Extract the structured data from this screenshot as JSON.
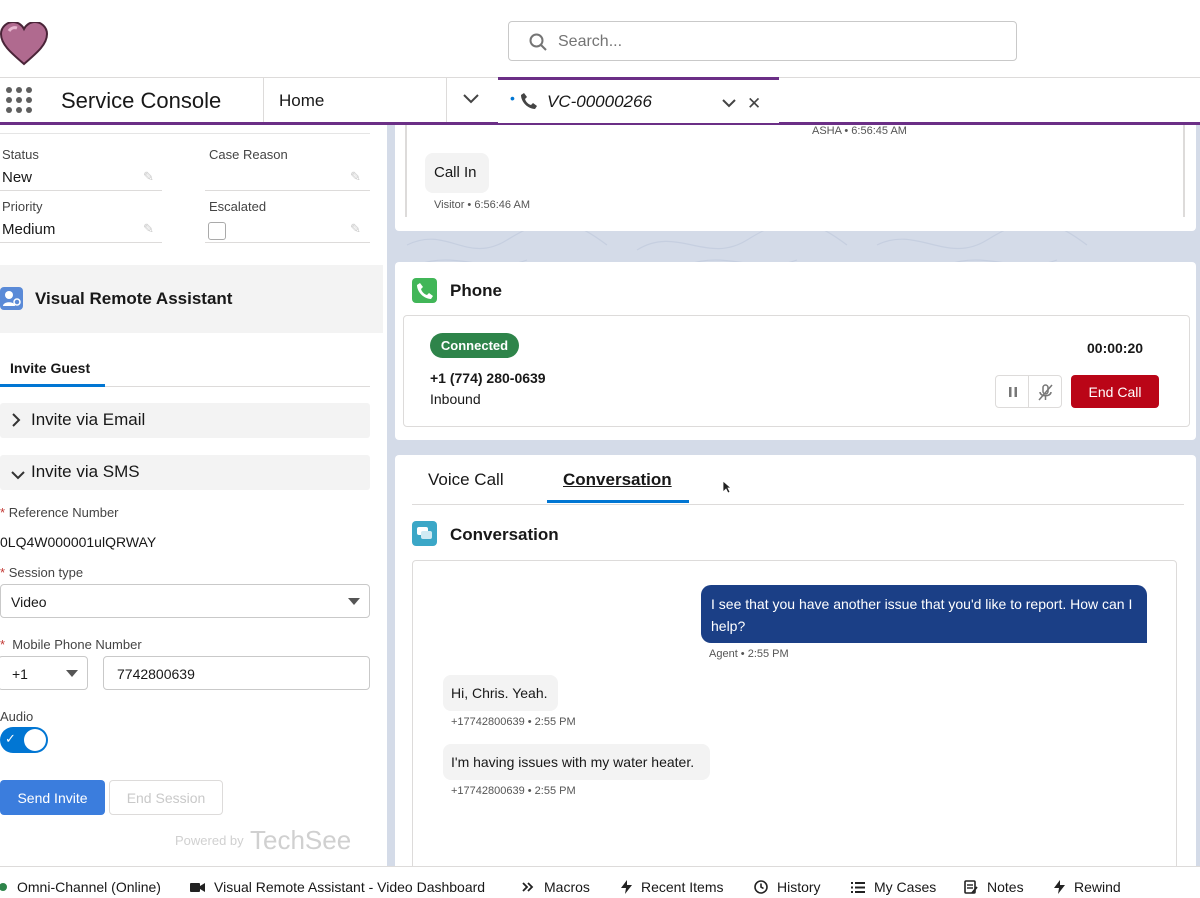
{
  "header": {
    "search_placeholder": "Search..."
  },
  "nav": {
    "app_name": "Service Console",
    "home_tab": "Home",
    "case_tab": "VC-00000266"
  },
  "record_fields": {
    "status_label": "Status",
    "status_value": "New",
    "case_reason_label": "Case Reason",
    "priority_label": "Priority",
    "priority_value": "Medium",
    "escalated_label": "Escalated"
  },
  "vra": {
    "title": "Visual Remote Assistant",
    "tab": "Invite Guest",
    "invite_email": "Invite via Email",
    "invite_sms": "Invite via SMS",
    "ref_label": "Reference Number",
    "ref_value": "0LQ4W000001ulQRWAY",
    "session_label": "Session type",
    "session_value": "Video",
    "phone_label": "Mobile Phone Number",
    "country_code": "+1",
    "phone_value": "7742800639",
    "audio_label": "Audio",
    "send_button": "Send Invite",
    "end_button": "End Session",
    "powered_by": "Powered by",
    "brand": "TechSee"
  },
  "transcript_top": {
    "header_meta": "ASHA • 6:56:45 AM",
    "message": "Call In",
    "message_meta": "Visitor • 6:56:46 AM"
  },
  "phone": {
    "title": "Phone",
    "status": "Connected",
    "timer": "00:00:20",
    "number": "+1 (774) 280-0639",
    "direction": "Inbound",
    "end_call": "End Call"
  },
  "tabs": [
    "Voice Call",
    "Conversation"
  ],
  "conversation": {
    "title": "Conversation",
    "messages": [
      {
        "text": "I see that you have another issue that you'd like to report. How can I help?",
        "meta": "Agent • 2:55 PM"
      },
      {
        "text": "Hi, Chris. Yeah.",
        "meta": "+17742800639 • 2:55 PM"
      },
      {
        "text": "I'm having issues with my water heater.",
        "meta": "+17742800639 • 2:55 PM"
      }
    ]
  },
  "footer": {
    "items": [
      "Omni-Channel (Online)",
      "Visual Remote Assistant - Video Dashboard",
      "Macros",
      "Recent Items",
      "History",
      "My Cases",
      "Notes",
      "Rewind"
    ]
  },
  "colors": {
    "accent": "#6b2f86",
    "brand_blue": "#0176d3",
    "agent_bubble": "#1b3f86",
    "connected": "#2e844a",
    "end_call": "#ba0517"
  },
  "icons": [
    "heart-logo-icon",
    "search-icon",
    "app-launcher-icon",
    "chevron-down-icon",
    "phone-icon",
    "close-icon",
    "pencil-icon",
    "vra-icon",
    "chevron-right-icon",
    "pause-icon",
    "mute-icon",
    "conversation-icon",
    "cursor-icon",
    "macros-icon",
    "bolt-icon",
    "clock-icon",
    "list-icon",
    "notes-icon",
    "video-icon",
    "status-dot-icon"
  ]
}
